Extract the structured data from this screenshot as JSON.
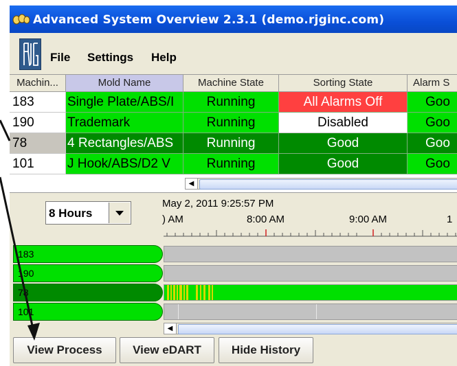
{
  "window": {
    "title": "Advanced System Overview 2.3.1 (demo.rjginc.com)"
  },
  "menu": {
    "items": [
      "File",
      "Settings",
      "Help"
    ]
  },
  "table": {
    "columns": [
      "Machin...",
      "Mold Name",
      "Machine State",
      "Sorting State",
      "Alarm S"
    ],
    "rows": [
      {
        "id": "183",
        "mold": "Single Plate/ABS/I",
        "machine_state": "Running",
        "sorting_state": "All Alarms Off",
        "alarm": "Goo"
      },
      {
        "id": "190",
        "mold": "Trademark",
        "machine_state": "Running",
        "sorting_state": "Disabled",
        "alarm": "Goo"
      },
      {
        "id": "78",
        "mold": "4 Rectangles/ABS",
        "machine_state": "Running",
        "sorting_state": "Good",
        "alarm": "Goo"
      },
      {
        "id": "101",
        "mold": "J Hook/ABS/D2 V",
        "machine_state": "Running",
        "sorting_state": "Good",
        "alarm": "Goo"
      }
    ]
  },
  "history": {
    "range_select": "8 Hours",
    "date": "May 2, 2011 9:25:57 PM",
    "time_labels": [
      ") AM",
      "8:00 AM",
      "9:00 AM",
      "1"
    ],
    "rows": [
      "183",
      "190",
      "78",
      "101"
    ]
  },
  "buttons": {
    "view_process": "View Process",
    "view_edart": "View eDART",
    "hide_history": "Hide History"
  },
  "colors": {
    "running_green": "#00e000",
    "good_dark_green": "#008a00",
    "alarm_red": "#ff4040",
    "title_blue": "#0a4fd8"
  },
  "icons": {
    "title": "app-icon",
    "logo": "rjg-logo",
    "scroll_left": "arrow-left-icon",
    "combo": "chevron-down-icon"
  }
}
